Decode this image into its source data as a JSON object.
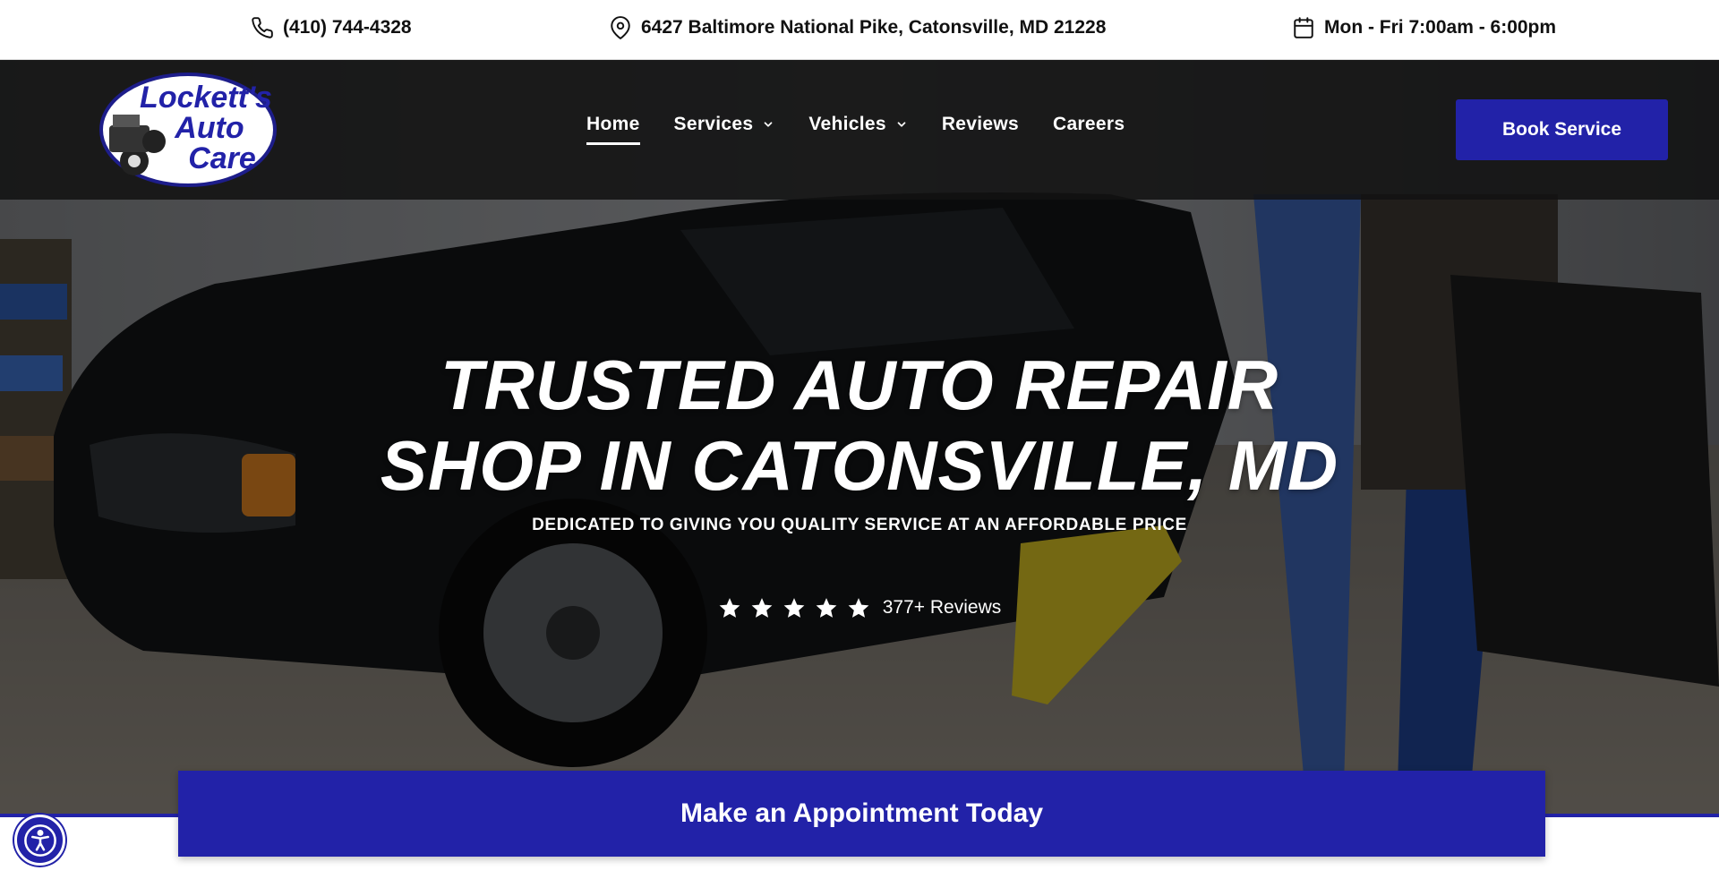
{
  "topbar": {
    "phone": "(410) 744-4328",
    "address": "6427 Baltimore National Pike, Catonsville, MD 21228",
    "hours": "Mon - Fri 7:00am - 6:00pm"
  },
  "logo": {
    "line1": "Lockett's",
    "line2": "Auto",
    "line3": "Care"
  },
  "nav": {
    "items": [
      {
        "label": "Home",
        "active": true
      },
      {
        "label": "Services",
        "dropdown": true
      },
      {
        "label": "Vehicles",
        "dropdown": true
      },
      {
        "label": "Reviews"
      },
      {
        "label": "Careers"
      }
    ],
    "book_label": "Book Service"
  },
  "hero": {
    "headline_line1": "TRUSTED AUTO REPAIR",
    "headline_line2": "SHOP IN CATONSVILLE, MD",
    "subheadline": "DEDICATED TO GIVING YOU QUALITY SERVICE AT AN AFFORDABLE PRICE",
    "rating_stars": 5,
    "reviews_text": "377+ Reviews"
  },
  "cta": {
    "label": "Make an Appointment Today"
  },
  "colors": {
    "brand_blue": "#2222a8",
    "nav_bg": "#121212",
    "text_white": "#ffffff"
  },
  "icons": {
    "phone": "phone-icon",
    "address": "map-pin-icon",
    "hours": "calendar-icon",
    "accessibility": "accessibility-icon"
  }
}
